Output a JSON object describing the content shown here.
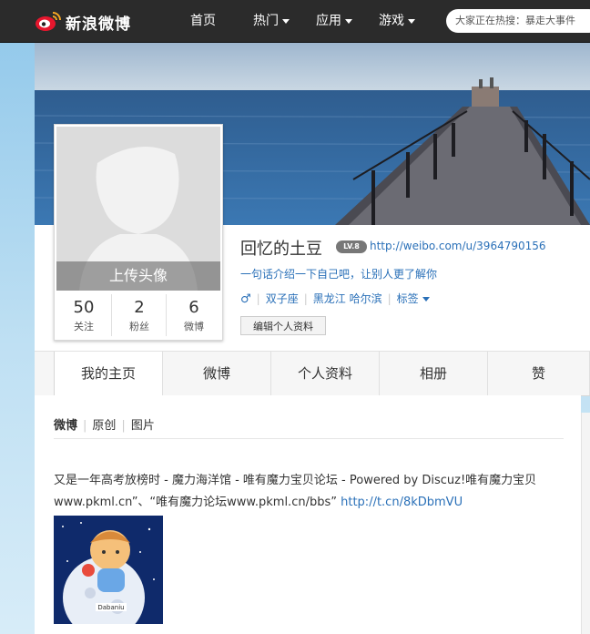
{
  "brand": {
    "name": "新浪微博"
  },
  "nav": [
    {
      "label": "首页",
      "has_menu": false
    },
    {
      "label": "热门",
      "has_menu": true
    },
    {
      "label": "应用",
      "has_menu": true
    },
    {
      "label": "游戏",
      "has_menu": true
    }
  ],
  "search": {
    "placeholder": "大家正在热搜：暴走大事件"
  },
  "avatar": {
    "upload_label": "上传头像"
  },
  "stats": [
    {
      "value": "50",
      "label": "关注"
    },
    {
      "value": "2",
      "label": "粉丝"
    },
    {
      "value": "6",
      "label": "微博"
    }
  ],
  "profile": {
    "username": "回忆的土豆",
    "level_badge": "LV.8",
    "url": "http://weibo.com/u/3964790156",
    "intro": "一句话介绍一下自己吧，让别人更了解你",
    "gender_symbol": "♂",
    "zodiac": "双子座",
    "location": "黑龙江 哈尔滨",
    "tags_label": "标签",
    "edit_label": "编辑个人资料"
  },
  "tabs": [
    "我的主页",
    "微博",
    "个人资料",
    "相册",
    "赞"
  ],
  "feed_tabs": [
    "微博",
    "原创",
    "图片"
  ],
  "post": {
    "text": "又是一年高考放榜时 - 魔力海洋馆 - 唯有魔力宝贝论坛 - Powered by Discuz!唯有魔力宝贝www.pkml.cn”、“唯有魔力论坛www.pkml.cn/bbs”",
    "link": "http://t.cn/8kDbmVU",
    "image_caption": "Dabaniu"
  },
  "colors": {
    "link": "#2a70b8",
    "topbar": "#2b2b2b"
  }
}
